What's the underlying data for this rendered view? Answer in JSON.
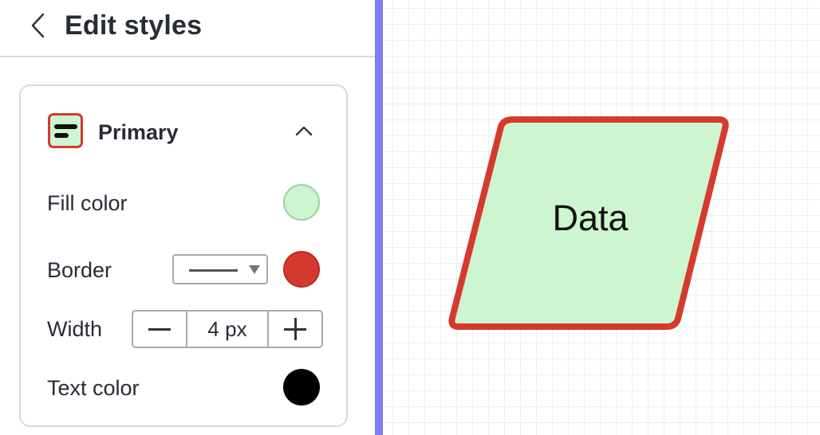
{
  "panel": {
    "title": "Edit styles",
    "back_icon": "chevron-left-icon"
  },
  "style_section": {
    "name": "Primary",
    "icon": "text-style-icon",
    "expanded": true,
    "collapse_icon": "chevron-up-icon",
    "fill": {
      "label": "Fill color",
      "color": "#cdf5cf"
    },
    "border": {
      "label": "Border",
      "style": "solid",
      "color": "#d63a2f"
    },
    "width": {
      "label": "Width",
      "value": "4 px",
      "minus_icon": "minus-icon",
      "plus_icon": "plus-icon"
    },
    "text": {
      "label": "Text color",
      "color": "#000000"
    }
  },
  "canvas": {
    "shape_type": "parallelogram",
    "shape_label": "Data",
    "shape_fill": "#cdf5cf",
    "shape_stroke": "#d63a2f",
    "accent": "#7c7ef4"
  }
}
